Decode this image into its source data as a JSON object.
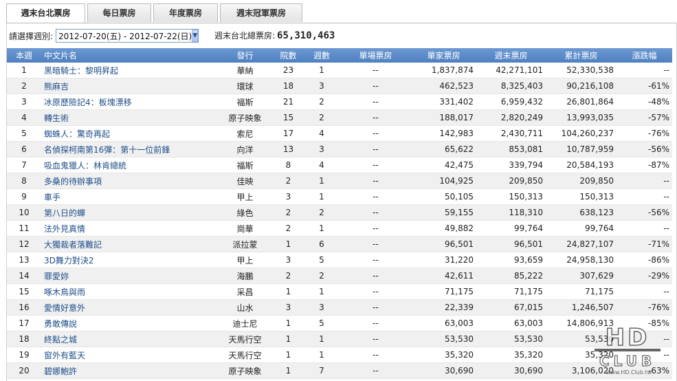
{
  "tabs": [
    {
      "label": "週末台北票房",
      "active": true
    },
    {
      "label": "每日票房",
      "active": false
    },
    {
      "label": "年度票房",
      "active": false
    },
    {
      "label": "週末冠軍票房",
      "active": false
    }
  ],
  "filter": {
    "label": "請選擇週別:",
    "selected": "2012-07-20(五) - 2012-07-22(日)"
  },
  "total": {
    "label": "週末台北總票房:",
    "value": "65,310,463"
  },
  "table": {
    "headers": [
      "本週",
      "中文片名",
      "發行",
      "院數",
      "週數",
      "單場票房",
      "單家票房",
      "週末票房",
      "累計票房",
      "漲跌幅"
    ],
    "rows": [
      [
        "1",
        "黑暗騎士：黎明昇起",
        "華納",
        "23",
        "1",
        "--",
        "1,837,874",
        "42,271,101",
        "52,330,538",
        "--"
      ],
      [
        "2",
        "熊麻吉",
        "環球",
        "18",
        "3",
        "--",
        "462,523",
        "8,325,403",
        "90,216,108",
        "-61%"
      ],
      [
        "3",
        "冰原歷險記4：板塊漂移",
        "福斯",
        "21",
        "2",
        "--",
        "331,402",
        "6,959,432",
        "26,801,864",
        "-48%"
      ],
      [
        "4",
        "轉生術",
        "原子映象",
        "15",
        "2",
        "--",
        "188,017",
        "2,820,249",
        "13,993,035",
        "-57%"
      ],
      [
        "5",
        "蜘蛛人：驚奇再起",
        "索尼",
        "17",
        "4",
        "--",
        "142,983",
        "2,430,711",
        "104,260,237",
        "-76%"
      ],
      [
        "6",
        "名偵探柯南第16彈：第十一位前鋒",
        "向洋",
        "13",
        "3",
        "--",
        "65,622",
        "853,081",
        "10,787,959",
        "-56%"
      ],
      [
        "7",
        "吸血鬼獵人：林肯總統",
        "福斯",
        "8",
        "4",
        "--",
        "42,475",
        "339,794",
        "20,584,193",
        "-87%"
      ],
      [
        "8",
        "多桑的待辦事項",
        "佳映",
        "2",
        "1",
        "--",
        "104,925",
        "209,850",
        "209,850",
        "--"
      ],
      [
        "9",
        "車手",
        "甲上",
        "3",
        "1",
        "--",
        "50,105",
        "150,313",
        "150,313",
        "--"
      ],
      [
        "10",
        "第八日的蟬",
        "綠色",
        "2",
        "2",
        "--",
        "59,155",
        "118,310",
        "638,123",
        "-56%"
      ],
      [
        "11",
        "法外見真情",
        "崗華",
        "2",
        "1",
        "--",
        "49,882",
        "99,764",
        "99,764",
        "--"
      ],
      [
        "12",
        "大獨裁者落難記",
        "派拉蒙",
        "1",
        "6",
        "--",
        "96,501",
        "96,501",
        "24,827,107",
        "-71%"
      ],
      [
        "13",
        "3D舞力對決2",
        "甲上",
        "3",
        "5",
        "--",
        "31,220",
        "93,659",
        "24,958,130",
        "-86%"
      ],
      [
        "14",
        "罪愛妳",
        "海鵬",
        "2",
        "2",
        "--",
        "42,611",
        "85,222",
        "307,629",
        "-29%"
      ],
      [
        "15",
        "啄木鳥與雨",
        "采昌",
        "1",
        "1",
        "--",
        "71,175",
        "71,175",
        "71,175",
        "--"
      ],
      [
        "16",
        "愛情好意外",
        "山水",
        "3",
        "3",
        "--",
        "22,339",
        "67,015",
        "1,246,507",
        "-76%"
      ],
      [
        "17",
        "勇敢傳說",
        "迪士尼",
        "1",
        "5",
        "--",
        "63,003",
        "63,003",
        "14,806,913",
        "-85%"
      ],
      [
        "18",
        "終點之城",
        "天馬行空",
        "1",
        "1",
        "--",
        "53,530",
        "53,530",
        "53,530",
        "--"
      ],
      [
        "19",
        "窗外有藍天",
        "天馬行空",
        "1",
        "1",
        "--",
        "35,320",
        "35,320",
        "35,320",
        "--"
      ],
      [
        "20",
        "碧娜鮑許",
        "原子映象",
        "1",
        "7",
        "--",
        "30,690",
        "30,690",
        "3,106,020",
        "-63%"
      ]
    ]
  },
  "watermark": {
    "text": "HD CLUB",
    "url_text": "www.HD.Club.tw"
  },
  "colors": {
    "header_bg": "#5a89c8",
    "link": "#1f4e8a",
    "row_alt": "#f0f0f0"
  }
}
